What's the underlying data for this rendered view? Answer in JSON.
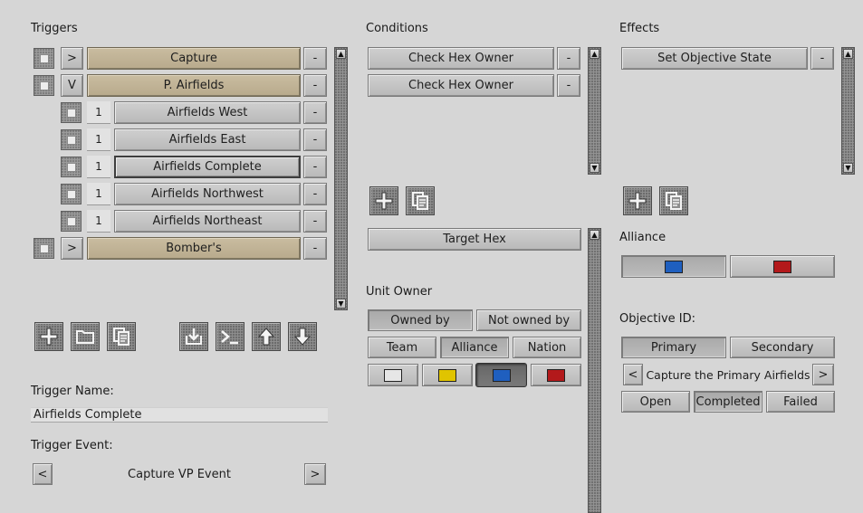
{
  "triggers": {
    "heading": "Triggers",
    "rows": [
      {
        "toggle": ">",
        "label": "Capture",
        "remove": "-"
      },
      {
        "toggle": "V",
        "label": "P. Airfields",
        "remove": "-"
      },
      {
        "count": "1",
        "label": "Airfields West",
        "remove": "-"
      },
      {
        "count": "1",
        "label": "Airfields East",
        "remove": "-"
      },
      {
        "count": "1",
        "label": "Airfields Complete",
        "remove": "-"
      },
      {
        "count": "1",
        "label": "Airfields Northwest",
        "remove": "-"
      },
      {
        "count": "1",
        "label": "Airfields Northeast",
        "remove": "-"
      },
      {
        "toggle": ">",
        "label": "Bomber's",
        "remove": "-"
      }
    ],
    "trigger_name_label": "Trigger Name:",
    "trigger_name_value": "Airfields Complete",
    "trigger_event_label": "Trigger Event:",
    "trigger_event_value": "Capture VP Event",
    "prev": "<",
    "next": ">"
  },
  "conditions": {
    "heading": "Conditions",
    "rows": [
      {
        "label": "Check Hex Owner",
        "remove": "-"
      },
      {
        "label": "Check Hex Owner",
        "remove": "-"
      }
    ],
    "target_hex": "Target Hex",
    "unit_owner_label": "Unit Owner",
    "owned_by": "Owned by",
    "not_owned_by": "Not owned by",
    "team": "Team",
    "alliance": "Alliance",
    "nation": "Nation",
    "colors": [
      "#e6e6e6",
      "#e0c400",
      "#1f5fbf",
      "#b3191b"
    ]
  },
  "effects": {
    "heading": "Effects",
    "rows": [
      {
        "label": "Set Objective State",
        "remove": "-"
      }
    ],
    "alliance_label": "Alliance",
    "alliance_colors": [
      "#1f5fbf",
      "#b3191b"
    ],
    "objective_id_label": "Objective ID:",
    "primary": "Primary",
    "secondary": "Secondary",
    "objective_prev": "<",
    "objective_next": ">",
    "objective_value": "Capture the Primary Airfields",
    "open": "Open",
    "completed": "Completed",
    "failed": "Failed"
  },
  "scroll": {
    "up": "▲",
    "down": "▼"
  }
}
